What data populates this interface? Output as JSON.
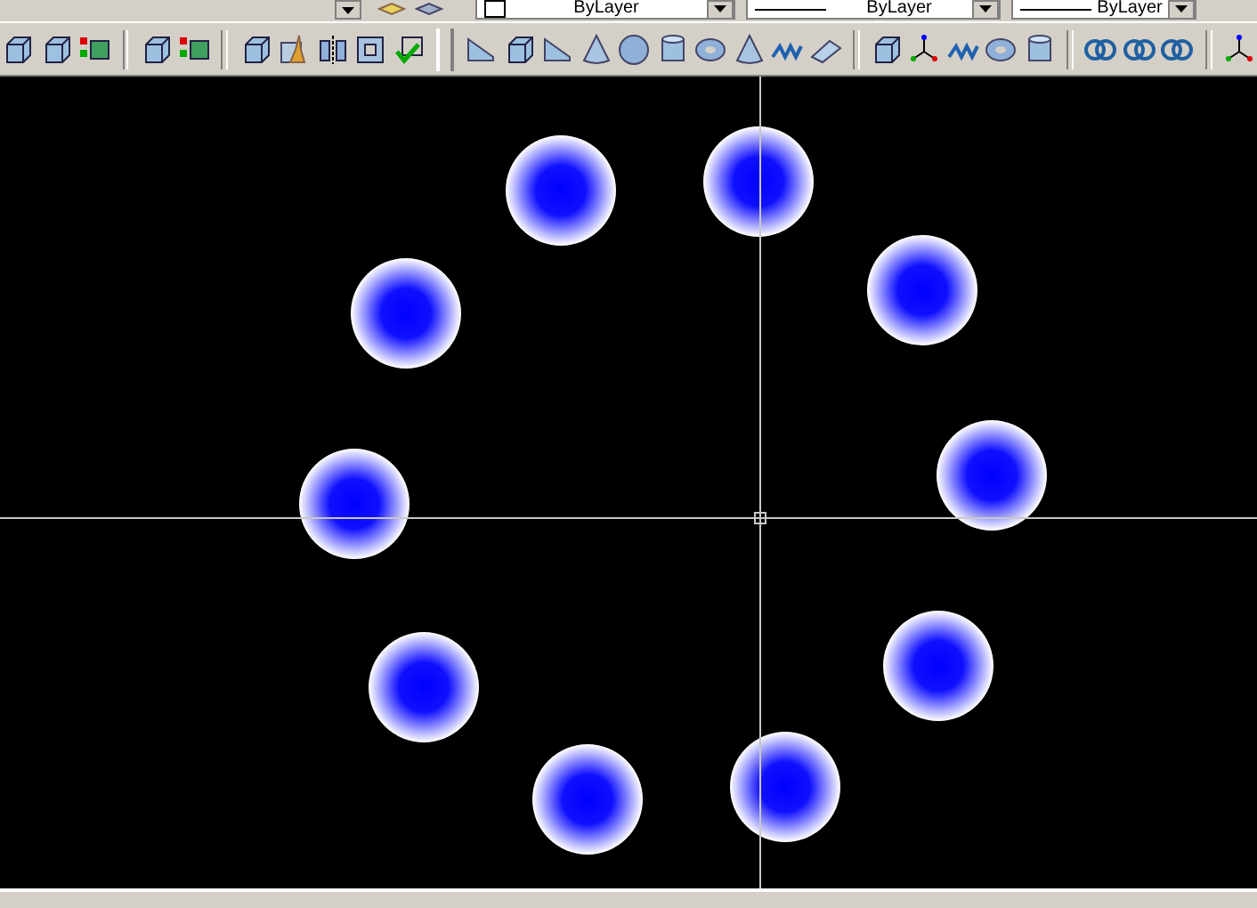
{
  "properties_bar": {
    "dropdowns": [
      {
        "value": "ByLayer",
        "kind": "color"
      },
      {
        "value": "ByLayer",
        "kind": "linetype"
      },
      {
        "value": "ByLayer",
        "kind": "lineweight"
      }
    ]
  }
}
